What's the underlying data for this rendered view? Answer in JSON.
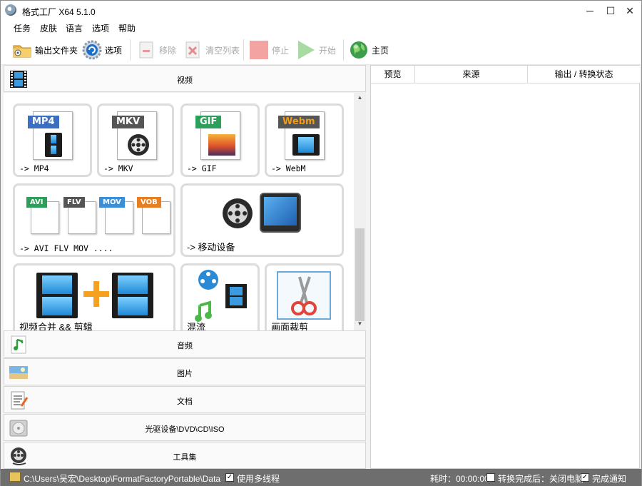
{
  "window": {
    "title": "格式工厂 X64 5.1.0",
    "minimize": "─",
    "maximize": "☐",
    "close": "✕"
  },
  "menu": [
    "任务",
    "皮肤",
    "语言",
    "选项",
    "帮助"
  ],
  "toolbar": {
    "output_folder": "输出文件夹",
    "options": "选项",
    "remove": "移除",
    "clear_list": "清空列表",
    "stop": "停止",
    "start": "开始",
    "home": "主页"
  },
  "categories": {
    "video": "视频",
    "audio": "音频",
    "image": "图片",
    "document": "文档",
    "disc": "光驱设备\\DVD\\CD\\ISO",
    "tools": "工具集"
  },
  "video_cards": {
    "mp4": {
      "badge": "MP4",
      "label": "-> MP4"
    },
    "mkv": {
      "badge": "MKV",
      "label": "-> MKV"
    },
    "gif": {
      "badge": "GIF",
      "label": "-> GIF"
    },
    "webm": {
      "badge": "Webm",
      "label": "-> WebM"
    },
    "multi": {
      "badges": [
        "AVI",
        "FLV",
        "MOV",
        "VOB"
      ],
      "label": "-> AVI FLV MOV ...."
    },
    "mobile": {
      "label": "-> 移动设备"
    },
    "join": {
      "label": "视频合并 && 剪辑"
    },
    "mux": {
      "label": "混流"
    },
    "crop": {
      "label": "画面裁剪"
    }
  },
  "task_table": {
    "columns": [
      "预览",
      "来源",
      "输出 / 转换状态"
    ]
  },
  "status": {
    "path": "C:\\Users\\吴宏\\Desktop\\FormatFactoryPortable\\Data",
    "multithread_label": "使用多线程",
    "multithread_checked": true,
    "elapsed": "耗时：00:00:00",
    "after_done_label": "转换完成后：关闭电脑",
    "after_done_checked": false,
    "notify_label": "完成通知",
    "notify_checked": true
  },
  "colors": {
    "mp4_badge": "#3b6fc2",
    "mkv_badge": "#555555",
    "gif_badge": "#2e9e5b",
    "webm_text": "#f39c12",
    "avi": "#2e9e5b",
    "flv": "#555555",
    "mov": "#3b8fd6",
    "vob": "#e67e22",
    "statusbar": "#6e6e6e",
    "stop_disabled": "#f4a3a3",
    "start_disabled": "#a8dba2"
  }
}
